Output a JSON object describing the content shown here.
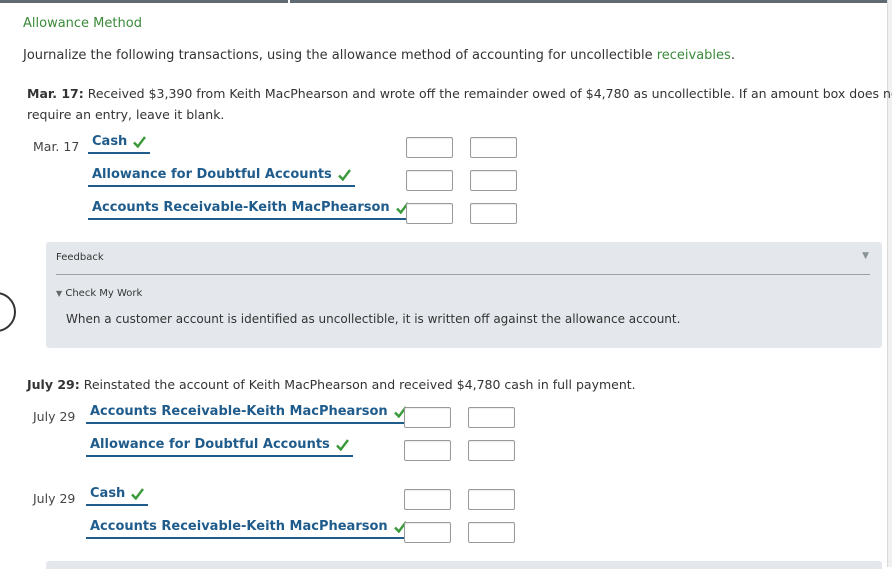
{
  "section_title": "Allowance Method",
  "instructions": {
    "text": "Journalize the following transactions, using the allowance method of accounting for uncollectible ",
    "link": "receivables",
    "tail": "."
  },
  "q1": {
    "label": "Mar. 17:",
    "text_line1": " Received $3,390 from Keith MacPhearson and wrote off the remainder owed of $4,780 as uncollectible. If an amount box does not",
    "text_line2": "require an entry, leave it blank.",
    "date": "Mar. 17",
    "accounts": [
      "Cash",
      "Allowance for Doubtful Accounts",
      "Accounts Receivable-Keith MacPhearson"
    ]
  },
  "feedback": {
    "title": "Feedback",
    "check_label": "Check My Work",
    "text": "When a customer account is identified as uncollectible, it is written off against the allowance account."
  },
  "q2": {
    "label": "July 29:",
    "text": " Reinstated the account of Keith MacPhearson and received $4,780 cash in full payment.",
    "entry1": {
      "date": "July 29",
      "accounts": [
        "Accounts Receivable-Keith MacPhearson",
        "Allowance for Doubtful Accounts"
      ]
    },
    "entry2": {
      "date": "July 29",
      "accounts": [
        "Cash",
        "Accounts Receivable-Keith MacPhearson"
      ]
    }
  },
  "icons": {
    "check": "green-checkmark-icon",
    "collapse": "triangle-down-icon"
  },
  "colors": {
    "account_blue": "#1f5c8c",
    "check_green": "#3a9a3a",
    "title_green": "#3a8a3a",
    "feedback_bg": "#e4e8ec"
  }
}
